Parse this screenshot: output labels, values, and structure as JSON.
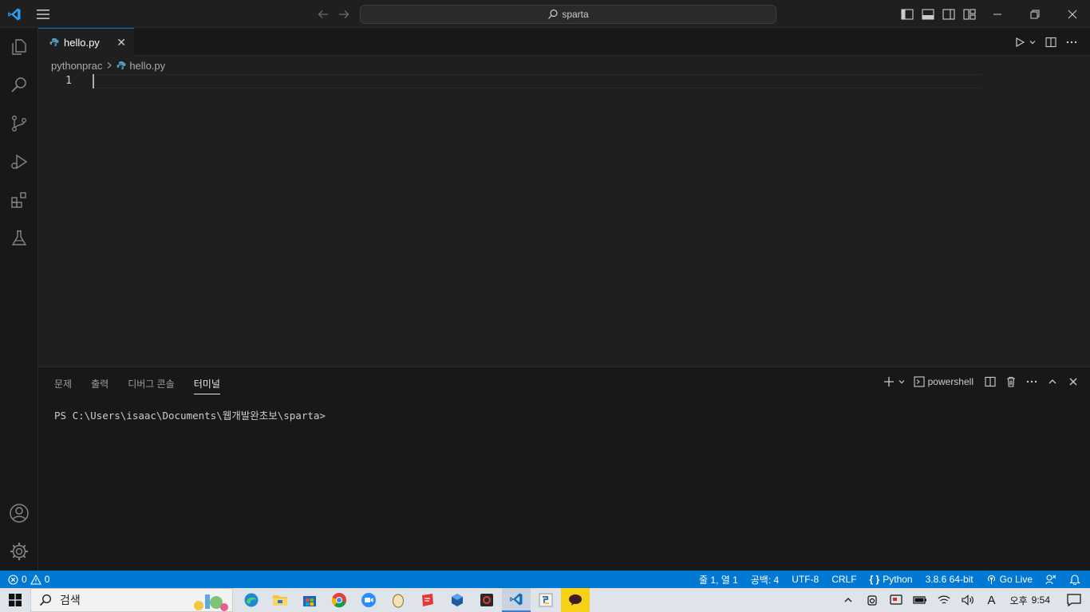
{
  "titlebar": {
    "search_text": "sparta"
  },
  "editor": {
    "tab_label": "hello.py",
    "breadcrumb": [
      "pythonprac",
      "hello.py"
    ],
    "line_number": "1"
  },
  "panel": {
    "tabs": [
      "문제",
      "출력",
      "디버그 콘솔",
      "터미널"
    ],
    "active_tab": "터미널",
    "terminal_name": "powershell",
    "prompt": "PS C:\\Users\\isaac\\Documents\\웹개발완초보\\sparta>"
  },
  "statusbar": {
    "errors": "0",
    "warnings": "0",
    "position": "줄 1, 열 1",
    "indent": "공백: 4",
    "encoding": "UTF-8",
    "eol": "CRLF",
    "language": "Python",
    "interpreter": "3.8.6 64-bit",
    "golive": "Go Live"
  },
  "taskbar": {
    "search_placeholder": "검색",
    "clock_period": "오후",
    "clock_time": "9:54",
    "ime": "A"
  },
  "colors": {
    "accent": "#0078d4",
    "statusbar": "#0078d4",
    "editor_bg": "#1f1f1f",
    "panel_bg": "#181818"
  }
}
